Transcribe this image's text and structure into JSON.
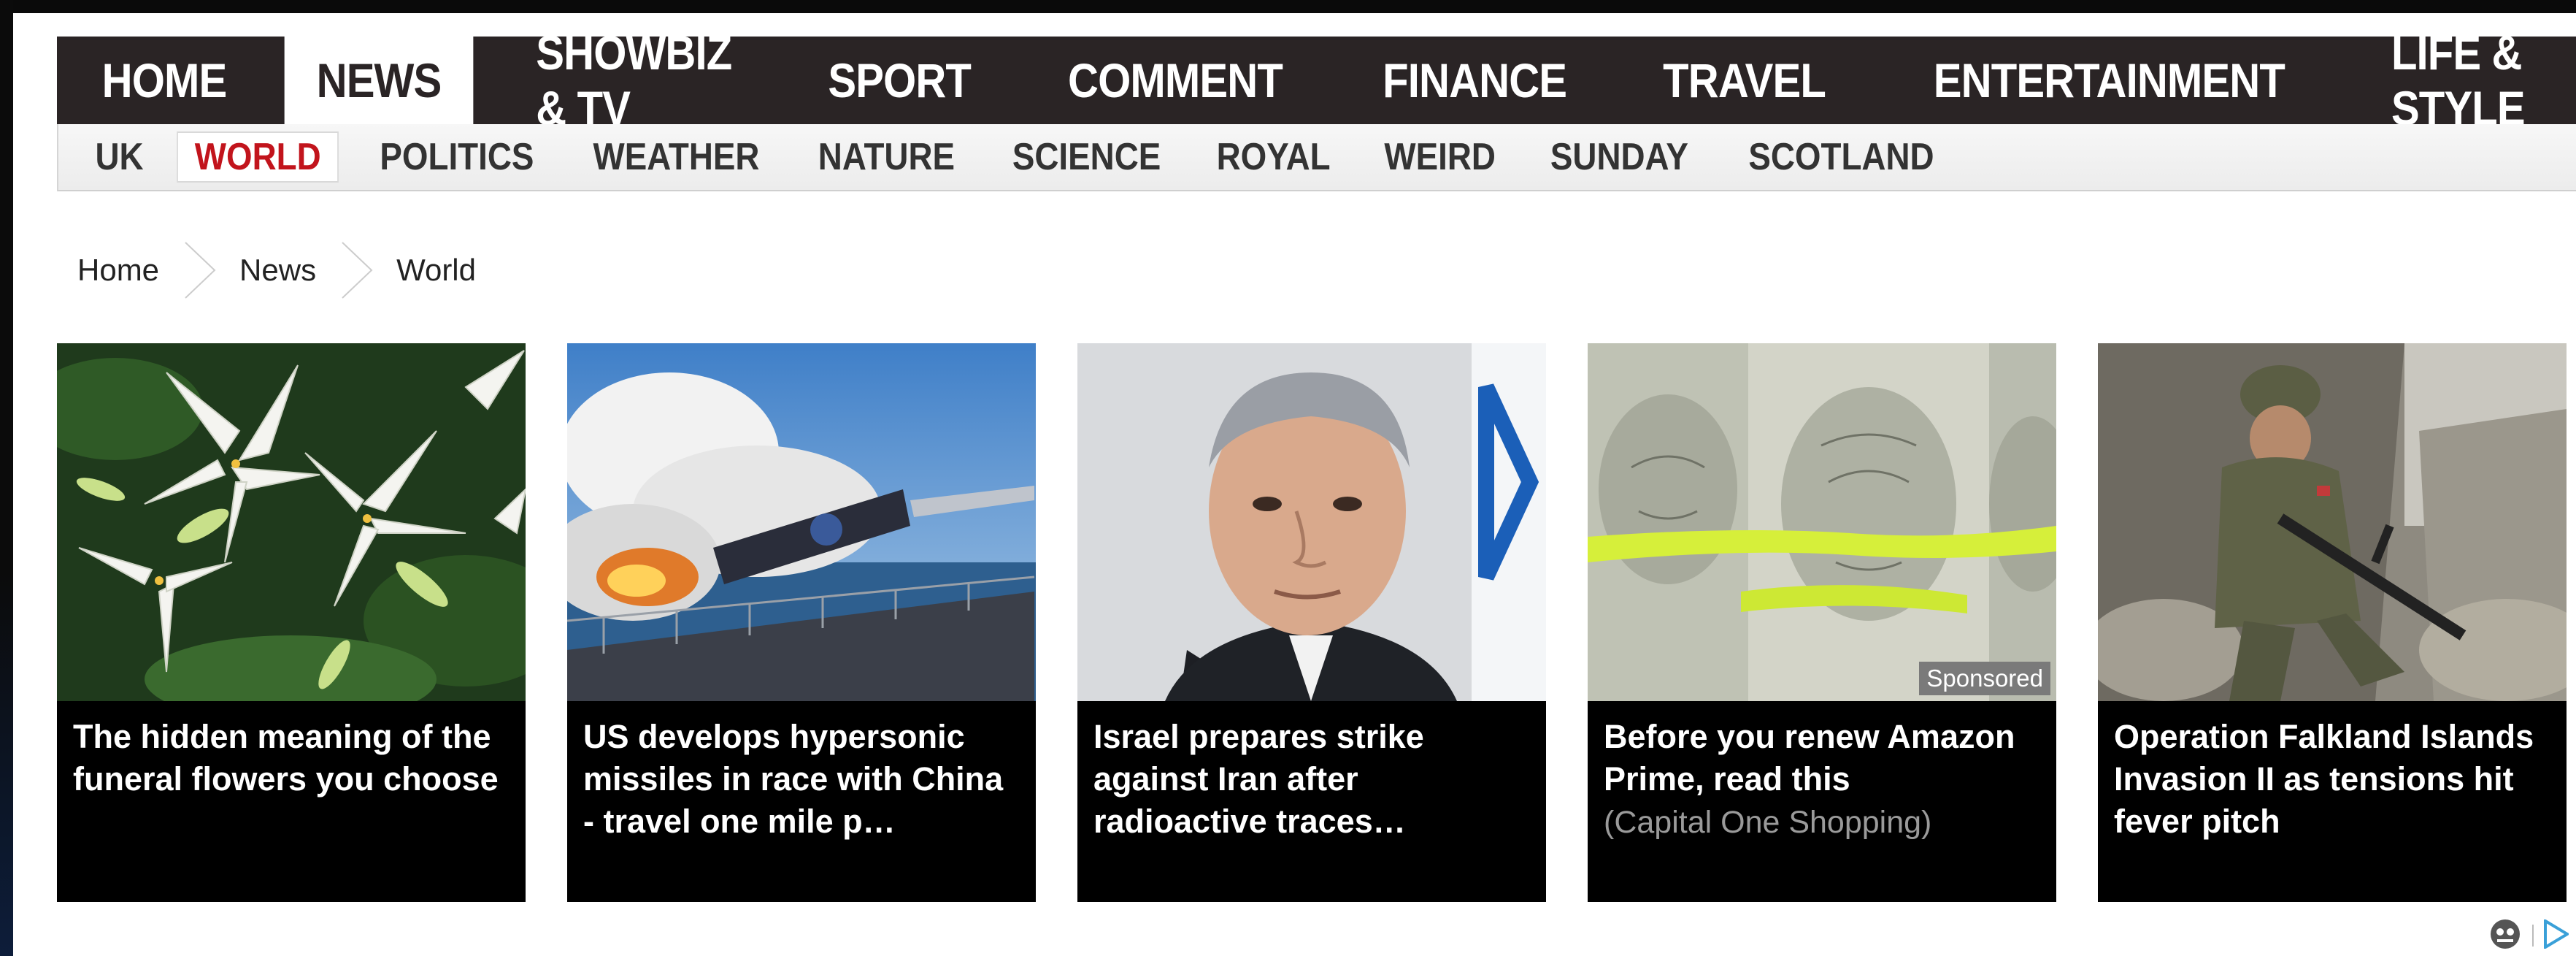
{
  "main_nav": {
    "items": [
      {
        "label": "HOME",
        "active": false
      },
      {
        "label": "NEWS",
        "active": true
      },
      {
        "label": "SHOWBIZ & TV",
        "active": false
      },
      {
        "label": "SPORT",
        "active": false
      },
      {
        "label": "COMMENT",
        "active": false
      },
      {
        "label": "FINANCE",
        "active": false
      },
      {
        "label": "TRAVEL",
        "active": false
      },
      {
        "label": "ENTERTAINMENT",
        "active": false
      },
      {
        "label": "LIFE & STYLE",
        "active": false
      }
    ]
  },
  "sub_nav": {
    "items": [
      {
        "label": "UK",
        "active": false
      },
      {
        "label": "WORLD",
        "active": true
      },
      {
        "label": "POLITICS",
        "active": false
      },
      {
        "label": "WEATHER",
        "active": false
      },
      {
        "label": "NATURE",
        "active": false
      },
      {
        "label": "SCIENCE",
        "active": false
      },
      {
        "label": "ROYAL",
        "active": false
      },
      {
        "label": "WEIRD",
        "active": false
      },
      {
        "label": "SUNDAY",
        "active": false
      },
      {
        "label": "SCOTLAND",
        "active": false
      }
    ]
  },
  "breadcrumb": [
    "Home",
    "News",
    "World"
  ],
  "cards": [
    {
      "headline": "The hidden meaning of the funeral flowers you choose",
      "image": "white-lilies",
      "sponsored": false,
      "source": ""
    },
    {
      "headline": "US develops hypersonic missiles in race with China - travel one mile p…",
      "image": "missile-launch",
      "sponsored": false,
      "source": ""
    },
    {
      "headline": "Israel prepares strike against Iran after radioactive traces…",
      "image": "politician-portrait",
      "sponsored": false,
      "source": ""
    },
    {
      "headline": "Before you renew Amazon Prime, read this",
      "image": "dollar-bills",
      "sponsored": true,
      "sponsored_label": "Sponsored",
      "source": "(Capital One Shopping)"
    },
    {
      "headline": "Operation Falkland Islands Invasion II as tensions hit fever pitch",
      "image": "soldier",
      "sponsored": false,
      "source": ""
    }
  ],
  "colors": {
    "nav_bg": "#2a2425",
    "accent_red": "#c2141c",
    "subnav_bg": "#f0f0f0",
    "card_bg": "#000000"
  },
  "icons": [
    "chevron-right-icon",
    "adchoices-icon",
    "ad-info-icon"
  ]
}
